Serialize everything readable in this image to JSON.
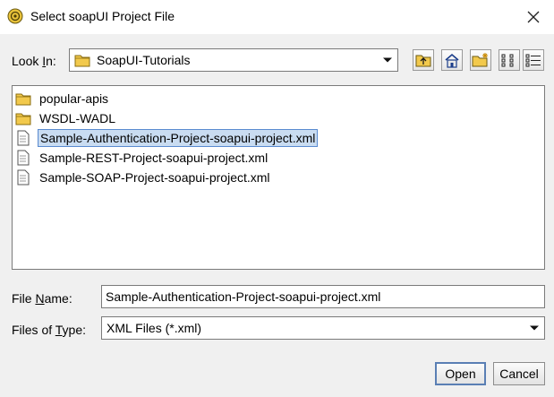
{
  "window": {
    "title": "Select soapUI Project File",
    "icon": "soapui-logo-icon"
  },
  "look_in": {
    "label": "Look In:",
    "label_underline": "I",
    "value": "SoapUI-Tutorials"
  },
  "toolbar": {
    "buttons": [
      "up-one-level-icon",
      "home-icon",
      "new-folder-icon",
      "list-view-icon",
      "details-view-icon"
    ]
  },
  "files": [
    {
      "name": "popular-apis",
      "type": "folder",
      "selected": false
    },
    {
      "name": "WSDL-WADL",
      "type": "folder",
      "selected": false
    },
    {
      "name": "Sample-Authentication-Project-soapui-project.xml",
      "type": "file",
      "selected": true
    },
    {
      "name": "Sample-REST-Project-soapui-project.xml",
      "type": "file",
      "selected": false
    },
    {
      "name": "Sample-SOAP-Project-soapui-project.xml",
      "type": "file",
      "selected": false
    }
  ],
  "file_name": {
    "label_before": "File ",
    "label_underline": "N",
    "label_after": "ame:",
    "value": "Sample-Authentication-Project-soapui-project.xml"
  },
  "file_type": {
    "label_before": "Files of ",
    "label_underline": "T",
    "label_after": "ype:",
    "value": "XML Files (*.xml)"
  },
  "buttons": {
    "open": "Open",
    "cancel": "Cancel"
  },
  "colors": {
    "selection_bg": "#c9dcf1",
    "selection_border": "#5a8bd0",
    "folder": "#f2c94c"
  }
}
